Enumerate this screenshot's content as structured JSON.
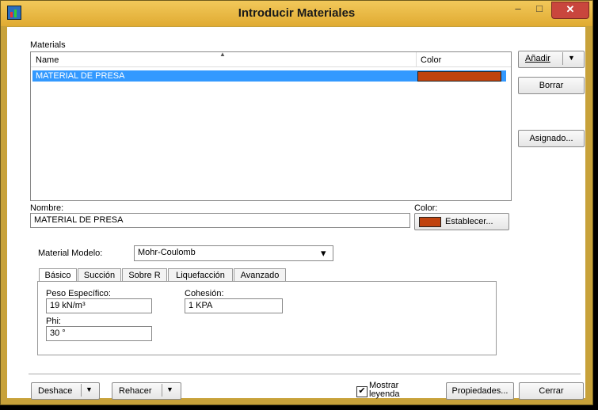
{
  "window": {
    "title": "Introducir Materiales",
    "minimize_glyph": "–",
    "maximize_glyph": "□",
    "close_glyph": "✕"
  },
  "materials": {
    "group_label": "Materials",
    "columns": {
      "name": "Name",
      "color": "Color"
    },
    "rows": [
      {
        "name": "MATERIAL DE PRESA",
        "color": "#c0430f"
      }
    ]
  },
  "side_buttons": {
    "add": "Añadir",
    "add_dropdown": "▼",
    "delete": "Borrar",
    "assign": "Asignado..."
  },
  "name_field": {
    "label": "Nombre:",
    "value": "MATERIAL DE PRESA"
  },
  "color_field": {
    "label": "Color:",
    "swatch": "#c0430f",
    "button": "Establecer..."
  },
  "model": {
    "label": "Material Modelo:",
    "value": "Mohr-Coulomb",
    "dropdown_icon": "▾"
  },
  "tabs": [
    "Básico",
    "Succión",
    "Sobre R",
    "Liquefacción",
    "Avanzado"
  ],
  "basic": {
    "unit_weight_label": "Peso Específico:",
    "unit_weight_value": "19 kN/m³",
    "cohesion_label": "Cohesión:",
    "cohesion_value": "1 KPA",
    "phi_label": "Phi:",
    "phi_value": "30 °"
  },
  "footer": {
    "undo": "Deshace",
    "redo": "Rehacer",
    "dropdown": "▼",
    "show_legend": "Mostrar leyenda",
    "show_legend_checked": "✔",
    "properties": "Propiedades...",
    "close": "Cerrar"
  }
}
